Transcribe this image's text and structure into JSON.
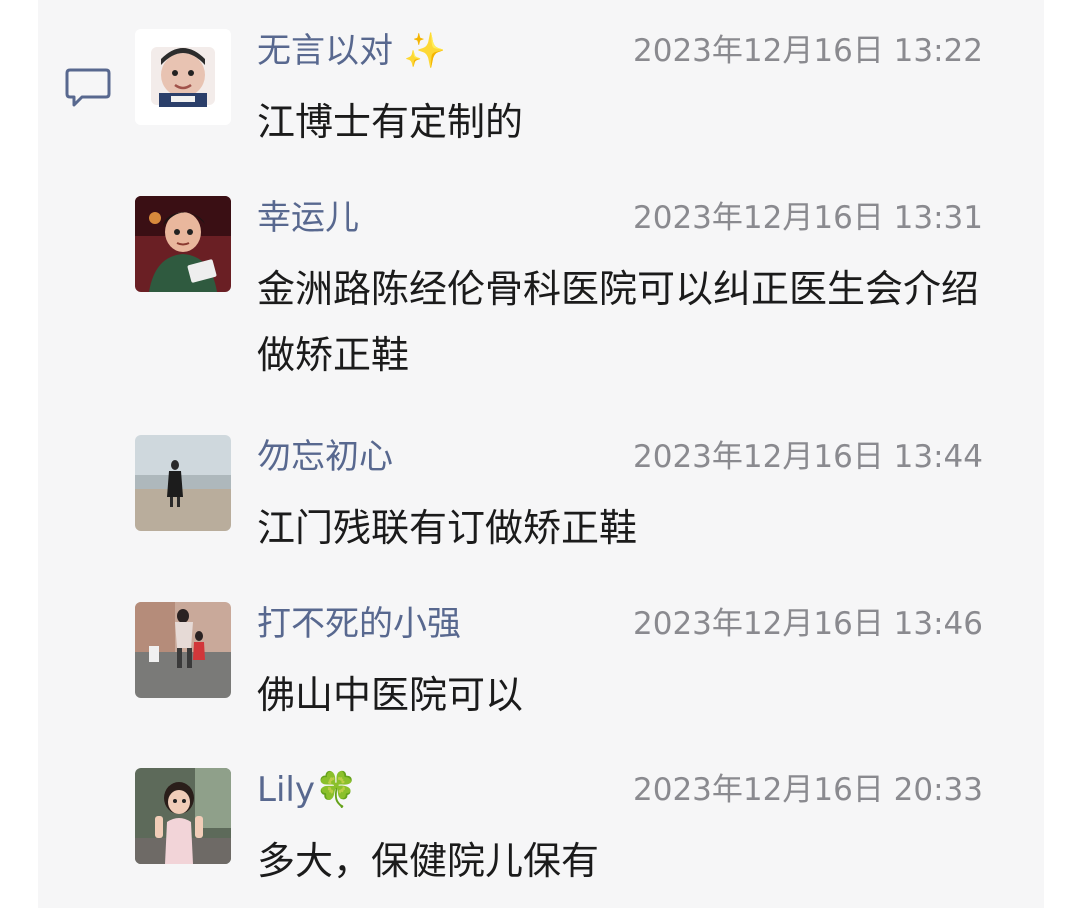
{
  "comments": [
    {
      "name": "无言以对",
      "emoji": "✨",
      "time": "2023年12月16日 13:22",
      "text": "江博士有定制的",
      "avatar_icon": "baby-face-avatar"
    },
    {
      "name": "幸运儿",
      "emoji": "",
      "time": "2023年12月16日 13:31",
      "text": "金洲路陈经伦骨科医院可以纠正医生会介绍做矫正鞋",
      "avatar_icon": "cartoon-woman-avatar"
    },
    {
      "name": "勿忘初心",
      "emoji": "",
      "time": "2023年12月16日 13:44",
      "text": "江门残联有订做矫正鞋",
      "avatar_icon": "beach-person-avatar"
    },
    {
      "name": "打不死的小强",
      "emoji": "",
      "time": "2023年12月16日 13:46",
      "text": "佛山中医院可以",
      "avatar_icon": "street-people-avatar"
    },
    {
      "name": "Lily",
      "emoji": "🍀",
      "time": "2023年12月16日 20:33",
      "text": "多大，保健院儿保有",
      "avatar_icon": "girl-photo-avatar"
    }
  ],
  "colors": {
    "name": "#58688f",
    "time": "#8a8a8f",
    "text": "#1b1b1b",
    "background": "#f6f6f7"
  }
}
